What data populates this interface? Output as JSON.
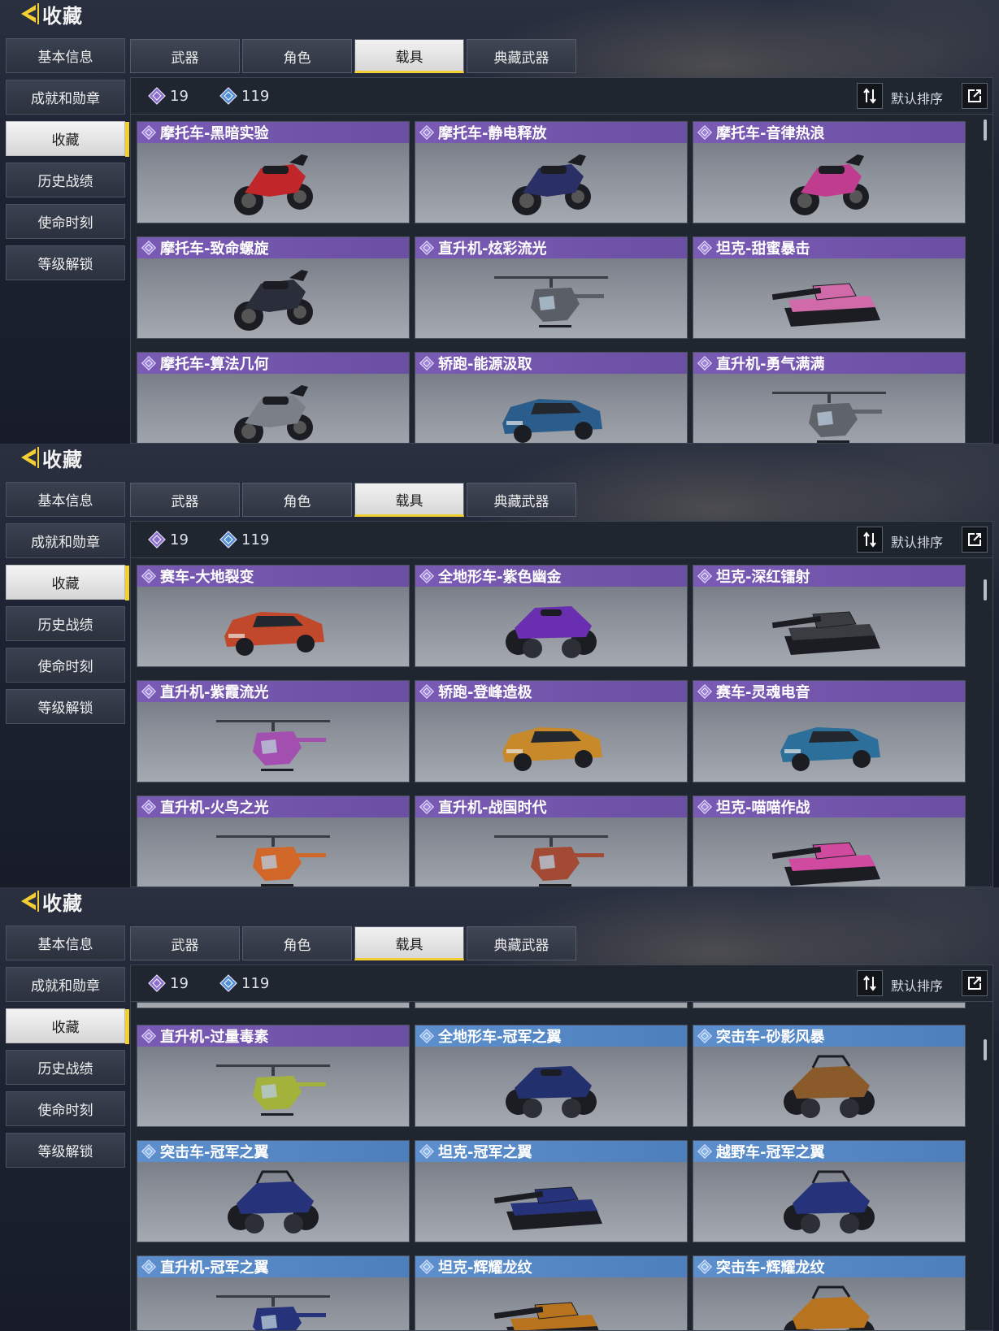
{
  "page": {
    "title": "收藏"
  },
  "sidebar": {
    "items": [
      "基本信息",
      "成就和勋章",
      "收藏",
      "历史战绩",
      "使命时刻",
      "等级解锁"
    ],
    "active_index": 2
  },
  "tabs": {
    "items": [
      "武器",
      "角色",
      "载具",
      "典藏武器"
    ],
    "active_index": 2
  },
  "stats": {
    "purple_count": "19",
    "blue_count": "119"
  },
  "sort": {
    "label": "默认排序"
  },
  "colors": {
    "accent": "#f2cf33",
    "purple_rarity": "#7a5bb4",
    "blue_rarity": "#5c8fcc"
  },
  "panels": [
    {
      "cards": [
        {
          "name": "摩托车-黑暗实验",
          "rarity": "purple",
          "icon": "motorcycle-icon",
          "color": "#c0262a"
        },
        {
          "name": "摩托车-静电释放",
          "rarity": "purple",
          "icon": "motorcycle-icon",
          "color": "#2a2f66"
        },
        {
          "name": "摩托车-音律热浪",
          "rarity": "purple",
          "icon": "motorcycle-icon",
          "color": "#c03c8e"
        },
        {
          "name": "摩托车-致命螺旋",
          "rarity": "purple",
          "icon": "motorcycle-icon",
          "color": "#2a2d3a"
        },
        {
          "name": "直升机-炫彩流光",
          "rarity": "purple",
          "icon": "helicopter-icon",
          "color": "#5a5e66"
        },
        {
          "name": "坦克-甜蜜暴击",
          "rarity": "purple",
          "icon": "tank-icon",
          "color": "#d06aa8"
        },
        {
          "name": "摩托车-算法几何",
          "rarity": "purple",
          "icon": "motorcycle-icon",
          "color": "#7a7f88"
        },
        {
          "name": "轿跑-能源汲取",
          "rarity": "purple",
          "icon": "car-icon",
          "color": "#2a5d8c"
        },
        {
          "name": "直升机-勇气满满",
          "rarity": "purple",
          "icon": "helicopter-icon",
          "color": "#5f646b"
        }
      ]
    },
    {
      "cards": [
        {
          "name": "赛车-大地裂变",
          "rarity": "purple",
          "icon": "car-icon",
          "color": "#c2482b"
        },
        {
          "name": "全地形车-紫色幽金",
          "rarity": "purple",
          "icon": "atv-icon",
          "color": "#6a2fb0"
        },
        {
          "name": "坦克-深红镭射",
          "rarity": "purple",
          "icon": "tank-icon",
          "color": "#3a3c42"
        },
        {
          "name": "直升机-紫霞流光",
          "rarity": "purple",
          "icon": "helicopter-icon",
          "color": "#a34fb0"
        },
        {
          "name": "轿跑-登峰造极",
          "rarity": "purple",
          "icon": "car-icon",
          "color": "#c8892a"
        },
        {
          "name": "赛车-灵魂电音",
          "rarity": "purple",
          "icon": "car-icon",
          "color": "#2c6f9a"
        },
        {
          "name": "直升机-火鸟之光",
          "rarity": "purple",
          "icon": "helicopter-icon",
          "color": "#d2672a"
        },
        {
          "name": "直升机-战国时代",
          "rarity": "purple",
          "icon": "helicopter-icon",
          "color": "#a34a35"
        },
        {
          "name": "坦克-喵喵作战",
          "rarity": "purple",
          "icon": "tank-icon",
          "color": "#d04aa0"
        }
      ]
    },
    {
      "cards": [
        {
          "name": "直升机-过量毒素",
          "rarity": "purple",
          "icon": "helicopter-icon",
          "color": "#a3b23a"
        },
        {
          "name": "全地形车-冠军之翼",
          "rarity": "blue",
          "icon": "atv-icon",
          "color": "#23306e"
        },
        {
          "name": "突击车-砂影风暴",
          "rarity": "blue",
          "icon": "buggy-icon",
          "color": "#8a5a2a"
        },
        {
          "name": "突击车-冠军之翼",
          "rarity": "blue",
          "icon": "buggy-icon",
          "color": "#26337a"
        },
        {
          "name": "坦克-冠军之翼",
          "rarity": "blue",
          "icon": "tank-icon",
          "color": "#26337a"
        },
        {
          "name": "越野车-冠军之翼",
          "rarity": "blue",
          "icon": "buggy-icon",
          "color": "#26337a"
        },
        {
          "name": "直升机-冠军之翼",
          "rarity": "blue",
          "icon": "helicopter-icon",
          "color": "#26337a"
        },
        {
          "name": "坦克-辉耀龙纹",
          "rarity": "blue",
          "icon": "tank-icon",
          "color": "#b8731f"
        },
        {
          "name": "突击车-辉耀龙纹",
          "rarity": "blue",
          "icon": "buggy-icon",
          "color": "#b8731f"
        }
      ]
    }
  ]
}
